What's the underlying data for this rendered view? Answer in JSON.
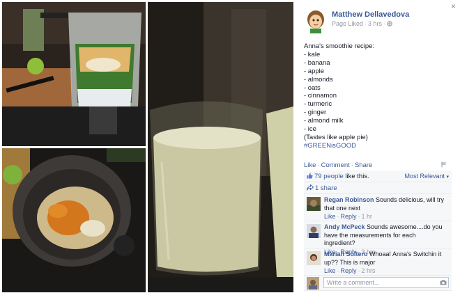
{
  "post": {
    "author": "Matthew Dellavedova",
    "status": "Page Liked",
    "time": "3 hrs",
    "lines": [
      "Anna's smoothie recipe:",
      "- kale",
      "- banana",
      "- apple",
      "- almonds",
      "- oats",
      "- cinnamon",
      "- turmeric",
      "- ginger",
      "- almond milk",
      "- ice",
      "(Tastes like apple pie)"
    ],
    "hashtag": "#GREENisGOOD"
  },
  "actions": {
    "like": "Like",
    "comment": "Comment",
    "share": "Share"
  },
  "ufi": {
    "likes_count": "79 people",
    "likes_suffix": " like this.",
    "sort": "Most Relevant",
    "shares": "1 share"
  },
  "comments": [
    {
      "name": "Regan Robinson",
      "text": "Sounds delicious, will try that one next",
      "like": "Like",
      "reply": "Reply",
      "time": "1 hr"
    },
    {
      "name": "Andy McPeck",
      "text": "Sounds awesome....do you have the measurements for each ingredient?",
      "like": "Like",
      "reply": "Reply",
      "time": "3 hrs"
    },
    {
      "name": "Mariah Soltero",
      "text": "Whoaa! Anna's Switchin it up?? This is major",
      "like": "Like",
      "reply": "Reply",
      "time": "2 hrs"
    }
  ],
  "write_comment": {
    "placeholder": "Write a comment..."
  },
  "close_glyph": "×",
  "icons": {
    "close": "close-icon",
    "globe": "globe-icon",
    "thumb": "thumbs-up-icon",
    "share": "share-icon",
    "camera": "camera-icon",
    "flag": "flag-icon"
  },
  "colors": {
    "link": "#3b5998",
    "meta": "#9197a3",
    "ufi_bg": "#f6f7f9"
  }
}
